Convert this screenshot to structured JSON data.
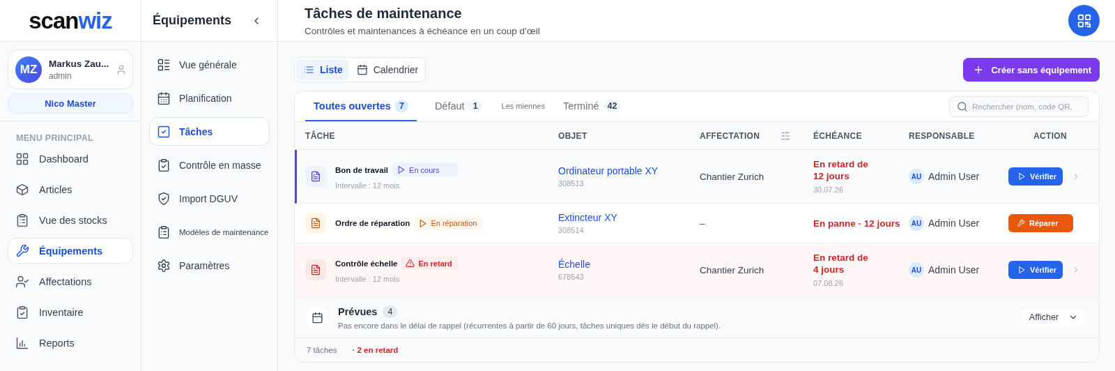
{
  "logo": {
    "dark": "scan",
    "accent": "wiz"
  },
  "user": {
    "initials": "MZ",
    "name": "Markus Zau...",
    "role": "admin",
    "workspace": "Nico Master"
  },
  "main_menu": {
    "heading": "MENU PRINCIPAL",
    "items": [
      {
        "label": "Dashboard",
        "selected": false
      },
      {
        "label": "Articles",
        "selected": false
      },
      {
        "label": "Vue des stocks",
        "selected": false
      },
      {
        "label": "Équipements",
        "selected": true
      },
      {
        "label": "Affectations",
        "selected": false
      },
      {
        "label": "Inventaire",
        "selected": false
      },
      {
        "label": "Reports",
        "selected": false
      }
    ]
  },
  "submenu": {
    "title": "Équipements",
    "items": [
      {
        "label": "Vue générale",
        "selected": false
      },
      {
        "label": "Planification",
        "selected": false
      },
      {
        "label": "Tâches",
        "selected": true
      },
      {
        "label": "Contrôle en masse",
        "selected": false
      },
      {
        "label": "Import DGUV",
        "selected": false
      },
      {
        "label": "Modèles de maintenance",
        "selected": false
      },
      {
        "label": "Paramètres",
        "selected": false
      }
    ]
  },
  "header": {
    "title": "Tâches de maintenance",
    "subtitle": "Contrôles et maintenances à échéance en un coup d’œil"
  },
  "view_toggle": [
    {
      "label": "Liste",
      "selected": true
    },
    {
      "label": "Calendrier",
      "selected": false
    }
  ],
  "create_button": "Créer sans équipement",
  "tabs": [
    {
      "label": "Toutes ouvertes",
      "count": "7",
      "selected": true
    },
    {
      "label": "Défaut",
      "count": "1",
      "selected": false
    },
    {
      "label": "Les miennes",
      "selected": false
    },
    {
      "label": "Terminé",
      "count": "42",
      "selected": false
    }
  ],
  "search": {
    "placeholder": "Rechercher (nom, code QR,"
  },
  "columns": [
    "TÂCHE",
    "OBJET",
    "AFFECTATION",
    "ÉCHÉANCE",
    "RESPONSABLE",
    "ACTION"
  ],
  "rows": [
    {
      "title": "Bon de travail",
      "status": {
        "kind": "in_progress",
        "label": "En cours"
      },
      "interval": "Intervalle : 12 mois",
      "object": "Ordinateur portable XY",
      "code": "308513",
      "assignment": "Chantier Zurich",
      "due": [
        "En retard de",
        "12 jours"
      ],
      "date": "30.07.26",
      "responsible": {
        "initials": "AU",
        "name": "Admin User"
      },
      "action": {
        "kind": "verify",
        "label": "Vérifier"
      },
      "expandable": true,
      "selected": true
    },
    {
      "title": "Ordre de réparation",
      "status": {
        "kind": "repair",
        "label": "En réparation"
      },
      "object": "Extincteur XY",
      "code": "308514",
      "assignment": "–",
      "due": [
        "En panne · 12 jours"
      ],
      "responsible": {
        "initials": "AU",
        "name": "Admin User"
      },
      "action": {
        "kind": "repair",
        "label": "Réparer"
      },
      "expandable": false,
      "selected": false
    },
    {
      "title": "Contrôle échelle",
      "status": {
        "kind": "overdue",
        "label": "En retard"
      },
      "interval": "Intervalle : 12 mois",
      "object": "Échelle",
      "code": "678543",
      "assignment": "Chantier Zurich",
      "due": [
        "En retard de",
        "4 jours"
      ],
      "date": "07.08.26",
      "responsible": {
        "initials": "AU",
        "name": "Admin User"
      },
      "action": {
        "kind": "verify",
        "label": "Vérifier"
      },
      "expandable": true,
      "selected": false
    }
  ],
  "planned": {
    "title": "Prévues",
    "count": "4",
    "description": "Pas encore dans le délai de rappel (récurrentes à partir de 60 jours, tâches uniques dès le début du rappel).",
    "button": "Afficher"
  },
  "footer": {
    "total": "7 tâches",
    "overdue": "· 2 en retard"
  }
}
